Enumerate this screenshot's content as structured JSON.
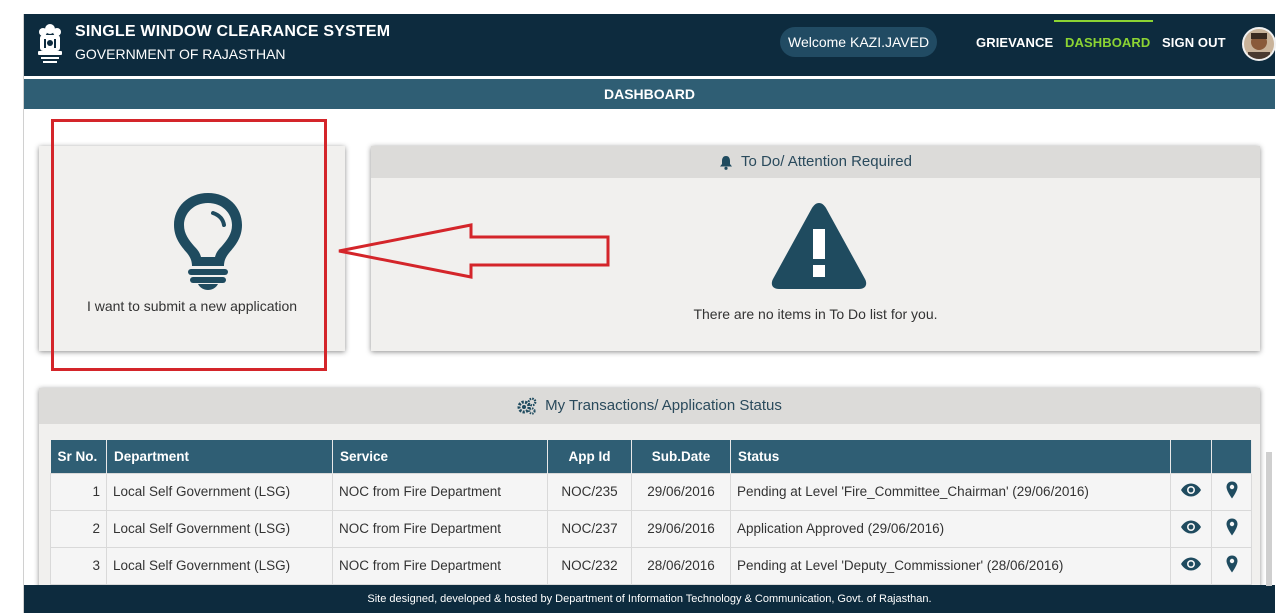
{
  "header": {
    "title": "SINGLE WINDOW CLEARANCE SYSTEM",
    "subtitle": "GOVERNMENT OF RAJASTHAN",
    "welcome": "Welcome KAZI.JAVED",
    "nav": {
      "grievance": "GRIEVANCE",
      "dashboard": "DASHBOARD",
      "signout": "SIGN OUT"
    }
  },
  "subbar": {
    "label": "DASHBOARD"
  },
  "new_application": {
    "label": "I want to submit a new application",
    "icon": "lightbulb-icon"
  },
  "todo": {
    "title": "To Do/ Attention Required",
    "message": "There are no items in To Do list for you.",
    "icon": "warning-icon"
  },
  "transactions": {
    "title": "My Transactions/ Application Status",
    "columns": [
      "Sr No.",
      "Department",
      "Service",
      "App Id",
      "Sub.Date",
      "Status"
    ],
    "rows": [
      {
        "sr": "1",
        "department": "Local Self Government (LSG)",
        "service": "NOC from Fire Department",
        "app_id": "NOC/235",
        "date": "29/06/2016",
        "status": "Pending at Level 'Fire_Committee_Chairman' (29/06/2016)"
      },
      {
        "sr": "2",
        "department": "Local Self Government (LSG)",
        "service": "NOC from Fire Department",
        "app_id": "NOC/237",
        "date": "29/06/2016",
        "status": "Application Approved (29/06/2016)"
      },
      {
        "sr": "3",
        "department": "Local Self Government (LSG)",
        "service": "NOC from Fire Department",
        "app_id": "NOC/232",
        "date": "28/06/2016",
        "status": "Pending at Level 'Deputy_Commissioner' (28/06/2016)"
      }
    ]
  },
  "footer": {
    "text": "Site designed, developed & hosted by Department of Information Technology & Communication, Govt. of Rajasthan."
  },
  "colors": {
    "header": "#0d2b3e",
    "bar": "#2f5e74",
    "accent": "#8cd433",
    "annotation": "#d4252a"
  }
}
